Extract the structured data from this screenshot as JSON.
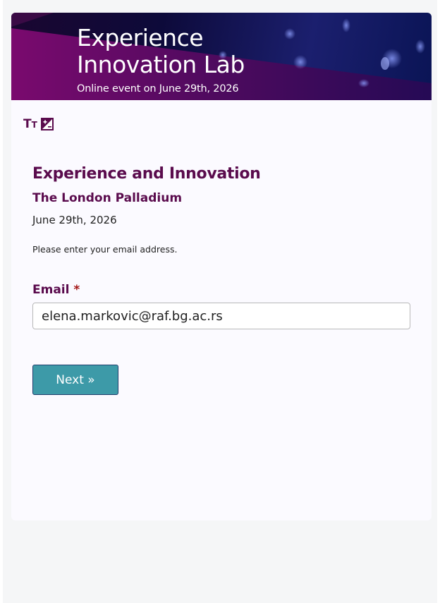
{
  "banner": {
    "title_line1": "Experience",
    "title_line2": "Innovation Lab",
    "subtitle": "Online event on June 29th, 2026"
  },
  "toolbar": {
    "text_size_big": "T",
    "text_size_small": "T",
    "text_size_icon": "text-size-icon",
    "contrast_icon": "contrast-icon"
  },
  "event": {
    "title": "Experience and Innovation",
    "venue": "The London Palladium",
    "date": "June 29th, 2026"
  },
  "form": {
    "instructions": "Please enter your email address.",
    "email_label": "Email",
    "required_marker": "*",
    "email_value": "elena.markovic@raf.bg.ac.rs",
    "next_label": "Next »"
  },
  "colors": {
    "brand": "#5a0b4d",
    "button": "#3d9aa8",
    "required": "#a31515",
    "card_bg": "#fbfaff",
    "page_bg": "#f5f6f7"
  }
}
